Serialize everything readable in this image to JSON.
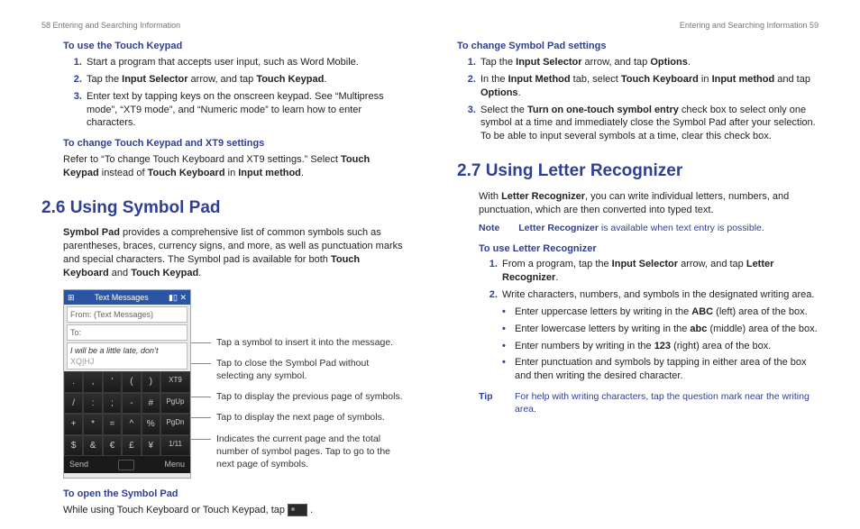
{
  "left": {
    "runhead": "58  Entering and Searching Information",
    "sub1": "To use the Touch Keypad",
    "s1_1a": "Start a program that accepts user input, such as Word Mobile.",
    "s1_2a": "Tap the ",
    "s1_2b": "Input Selector",
    "s1_2c": " arrow, and tap ",
    "s1_2d": "Touch Keypad",
    "s1_2e": ".",
    "s1_3": "Enter text by tapping keys on the onscreen keypad. See “Multipress mode”, “XT9 mode”, and “Numeric mode” to learn how to enter characters.",
    "sub2": "To change Touch Keypad and XT9 settings",
    "p2a": "Refer to “To change Touch Keyboard and XT9 settings.” Select ",
    "p2b": "Touch Keypad",
    "p2c": " instead of ",
    "p2d": "Touch Keyboard",
    "p2e": " in ",
    "p2f": "Input method",
    "p2g": ".",
    "sec": "2.6  Using Symbol Pad",
    "p3a": "Symbol Pad",
    "p3b": " provides a comprehensive list of common symbols such as parentheses, braces, currency signs, and more, as well as punctuation marks and special characters. The Symbol pad is available for both ",
    "p3c": "Touch Keyboard",
    "p3d": " and ",
    "p3e": "Touch Keypad",
    "p3f": ".",
    "phone": {
      "title": "Text Messages",
      "from": "From: (Text Messages)",
      "to": "To:",
      "body": "I will be a little late, don’t",
      "cursor": "XQ|HJ",
      "r1": [
        ".",
        ",",
        "'",
        "(",
        ")",
        "XT9"
      ],
      "r2": [
        "/",
        ":",
        ";",
        "-",
        "#",
        "PgUp"
      ],
      "r3": [
        "+",
        "*",
        "=",
        "^",
        "%",
        "PgDn"
      ],
      "r4": [
        "$",
        "&",
        "€",
        "£",
        "¥",
        "1/11"
      ],
      "send": "Send",
      "menu": "Menu"
    },
    "c1": "Tap a symbol to insert it into the message.",
    "c2": "Tap to close the Symbol Pad without selecting any symbol.",
    "c3": "Tap to display the previous page of symbols.",
    "c4": "Tap to display the next page of symbols.",
    "c5": "Indicates the current page and the total number of symbol pages. Tap to go to the next page of symbols.",
    "sub3": "To open the Symbol Pad",
    "p4": "While using Touch Keyboard or Touch Keypad, tap "
  },
  "right": {
    "runhead": "Entering and Searching Information  59",
    "sub1": "To change Symbol Pad settings",
    "s1_1a": "Tap the ",
    "s1_1b": "Input Selector",
    "s1_1c": " arrow, and tap ",
    "s1_1d": "Options",
    "s1_1e": ".",
    "s1_2a": "In the ",
    "s1_2b": "Input Method",
    "s1_2c": " tab, select ",
    "s1_2d": "Touch Keyboard",
    "s1_2e": " in ",
    "s1_2f": "Input method",
    "s1_2g": " and tap ",
    "s1_2h": "Options",
    "s1_2i": ".",
    "s1_3a": "Select the ",
    "s1_3b": "Turn on one-touch symbol entry",
    "s1_3c": " check box to select only one symbol at a time and immediately close the Symbol Pad after your selection. To be able to input several symbols at a time, clear this check box.",
    "sec": "2.7  Using Letter Recognizer",
    "p1a": "With ",
    "p1b": "Letter Recognizer",
    "p1c": ", you can write individual letters, numbers, and punctuation, which are then converted into typed text.",
    "noteLabel": "Note",
    "noteA": "Letter Recognizer",
    "noteB": " is available when text entry is possible.",
    "sub2": "To use Letter Recognizer",
    "s2_1a": "From a program, tap the ",
    "s2_1b": "Input Selector",
    "s2_1c": " arrow, and tap ",
    "s2_1d": "Letter Recognizer",
    "s2_1e": ".",
    "s2_2": "Write characters, numbers, and symbols in the designated writing area.",
    "b1a": "Enter uppercase letters by writing in the ",
    "b1b": "ABC",
    "b1c": " (left) area of the box.",
    "b2a": "Enter lowercase letters by writing in the ",
    "b2b": "abc",
    "b2c": " (middle) area of the box.",
    "b3a": "Enter numbers by writing in the ",
    "b3b": "123",
    "b3c": " (right) area of the box.",
    "b4": "Enter punctuation and symbols by tapping in either area of the box and then writing the desired character.",
    "tipLabel": "Tip",
    "tip": "For help with writing characters, tap the question mark near the writing area."
  }
}
